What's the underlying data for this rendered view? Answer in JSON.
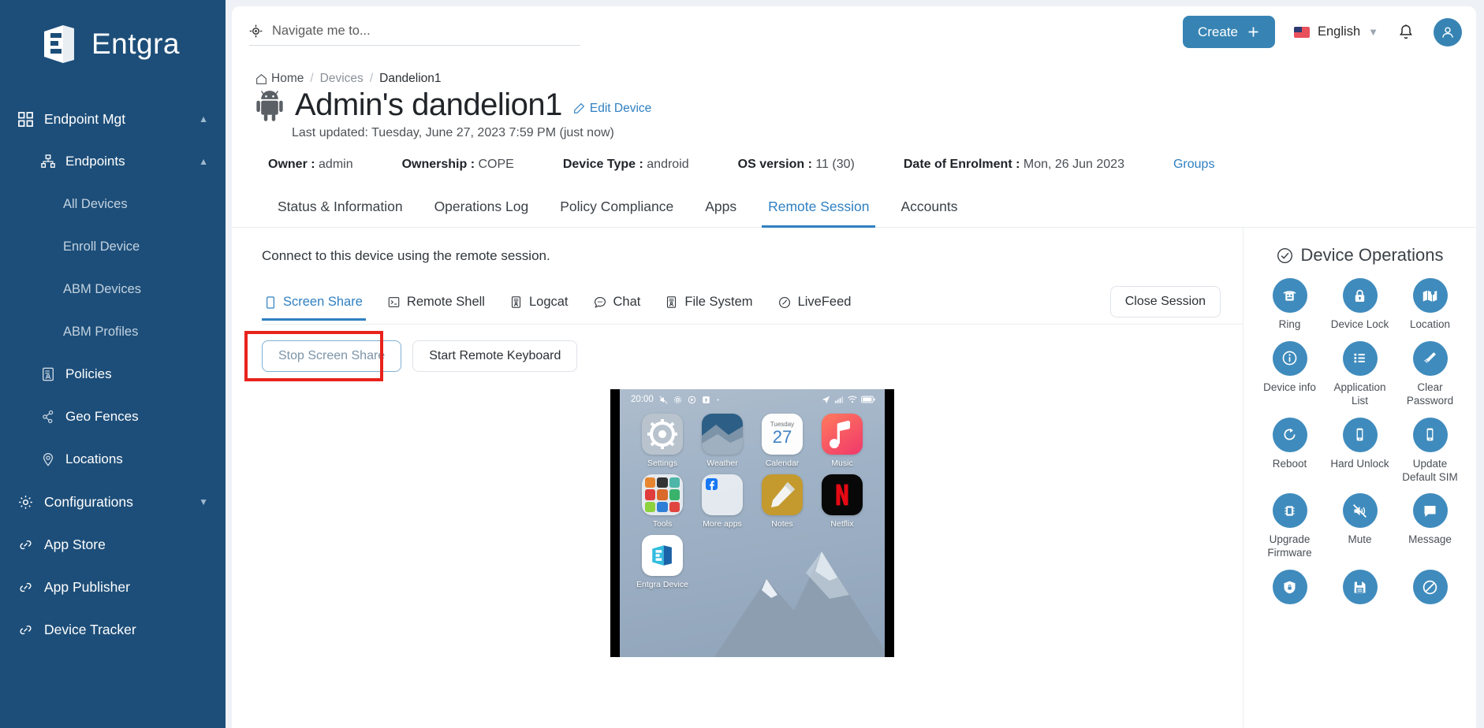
{
  "brand": {
    "name": "Entgra",
    "logo_icon": "entgra-logo-icon"
  },
  "sidebar": {
    "sections": [
      {
        "label": "Endpoint Mgt",
        "icon": "grid-icon",
        "level": "top",
        "expanded": true,
        "chevron": "chevron-up-icon"
      },
      {
        "label": "Endpoints",
        "icon": "sitemap-icon",
        "level": "sub",
        "expanded": true,
        "chevron": "chevron-up-icon"
      },
      {
        "label": "All Devices",
        "icon": "",
        "level": "leaf"
      },
      {
        "label": "Enroll Device",
        "icon": "",
        "level": "leaf"
      },
      {
        "label": "ABM Devices",
        "icon": "",
        "level": "leaf"
      },
      {
        "label": "ABM Profiles",
        "icon": "",
        "level": "leaf"
      },
      {
        "label": "Policies",
        "icon": "policy-icon",
        "level": "sub"
      },
      {
        "label": "Geo Fences",
        "icon": "geofence-icon",
        "level": "sub"
      },
      {
        "label": "Locations",
        "icon": "location-pin-icon",
        "level": "sub"
      },
      {
        "label": "Configurations",
        "icon": "gear-icon",
        "level": "top",
        "expanded": false,
        "chevron": "chevron-down-icon"
      },
      {
        "label": "App Store",
        "icon": "link-icon",
        "level": "top"
      },
      {
        "label": "App Publisher",
        "icon": "link-icon",
        "level": "top"
      },
      {
        "label": "Device Tracker",
        "icon": "link-icon",
        "level": "top"
      }
    ]
  },
  "topbar": {
    "search_placeholder": "Navigate me to...",
    "search_value": "",
    "search_icon": "navigate-icon",
    "create_label": "Create",
    "create_icon": "plus-icon",
    "language": "English",
    "language_chevron": "chevron-down-icon",
    "bell_icon": "bell-icon",
    "avatar_icon": "user-avatar-icon"
  },
  "breadcrumb": {
    "home": "Home",
    "items": [
      "Devices",
      "Dandelion1"
    ],
    "home_icon": "home-icon",
    "separator": "/"
  },
  "device": {
    "platform_icon": "android-robot-icon",
    "title": "Admin's dandelion1",
    "edit_label": "Edit Device",
    "edit_icon": "pencil-icon",
    "last_updated": "Last updated: Tuesday, June 27, 2023 7:59 PM (just now)",
    "meta": [
      {
        "key": "Owner :",
        "value": "admin"
      },
      {
        "key": "Ownership :",
        "value": "COPE"
      },
      {
        "key": "Device Type :",
        "value": "android"
      },
      {
        "key": "OS version :",
        "value": "11 (30)"
      },
      {
        "key": "Date of Enrolment :",
        "value": "Mon, 26 Jun 2023"
      }
    ],
    "groups_link": "Groups"
  },
  "tabs": [
    {
      "label": "Status & Information",
      "active": false
    },
    {
      "label": "Operations Log",
      "active": false
    },
    {
      "label": "Policy Compliance",
      "active": false
    },
    {
      "label": "Apps",
      "active": false
    },
    {
      "label": "Remote Session",
      "active": true
    },
    {
      "label": "Accounts",
      "active": false
    }
  ],
  "remote_session": {
    "description": "Connect to this device using the remote session.",
    "subtabs": [
      {
        "label": "Screen Share",
        "icon": "mobile-screen-icon",
        "active": true
      },
      {
        "label": "Remote Shell",
        "icon": "terminal-icon",
        "active": false
      },
      {
        "label": "Logcat",
        "icon": "log-icon",
        "active": false
      },
      {
        "label": "Chat",
        "icon": "chat-bubble-icon",
        "active": false
      },
      {
        "label": "File System",
        "icon": "file-system-icon",
        "active": false
      },
      {
        "label": "LiveFeed",
        "icon": "livefeed-icon",
        "active": false
      }
    ],
    "close_session_label": "Close Session",
    "stop_screen_share_label": "Stop Screen Share",
    "start_remote_keyboard_label": "Start Remote Keyboard",
    "highlight_color": "#e8231c",
    "accent_color": "#2f80c2"
  },
  "phone_preview": {
    "status_time": "20:00",
    "status_icons_left": [
      "mute-icon",
      "gear-icon",
      "cast-icon",
      "vpn-icon",
      "dot-icon"
    ],
    "status_icons_right": [
      "location-arrow-icon",
      "signal-icon",
      "wifi-icon",
      "battery-icon"
    ],
    "apps": [
      {
        "label": "Settings",
        "icon": "settings-gear-icon"
      },
      {
        "label": "Weather",
        "icon": "weather-icon"
      },
      {
        "label": "Calendar",
        "icon": "calendar-icon",
        "day_name": "Tuesday",
        "day_number": "27"
      },
      {
        "label": "Music",
        "icon": "music-note-icon"
      },
      {
        "label": "Tools",
        "icon": "folder-tools-icon"
      },
      {
        "label": "More apps",
        "icon": "folder-more-apps-icon"
      },
      {
        "label": "Notes",
        "icon": "notes-pencil-icon"
      },
      {
        "label": "Netflix",
        "icon": "netflix-icon"
      },
      {
        "label": "Entgra Device",
        "icon": "entgra-app-icon"
      }
    ]
  },
  "device_operations": {
    "title": "Device Operations",
    "title_icon": "check-circle-icon",
    "accent_color": "#3f8bbd",
    "operations": [
      {
        "label": "Ring",
        "icon": "ring-phone-icon"
      },
      {
        "label": "Device Lock",
        "icon": "lock-icon"
      },
      {
        "label": "Location",
        "icon": "map-icon"
      },
      {
        "label": "Device info",
        "icon": "info-icon"
      },
      {
        "label": "Application List",
        "icon": "list-icon"
      },
      {
        "label": "Clear Password",
        "icon": "broom-icon"
      },
      {
        "label": "Reboot",
        "icon": "reboot-icon"
      },
      {
        "label": "Hard Unlock",
        "icon": "mobile-icon"
      },
      {
        "label": "Update Default SIM",
        "icon": "sim-mobile-icon"
      },
      {
        "label": "Upgrade Firmware",
        "icon": "chip-icon"
      },
      {
        "label": "Mute",
        "icon": "mute-speaker-icon"
      },
      {
        "label": "Message",
        "icon": "message-icon"
      },
      {
        "label": "",
        "icon": "shield-lock-icon"
      },
      {
        "label": "",
        "icon": "save-disk-icon"
      },
      {
        "label": "",
        "icon": "block-icon"
      }
    ]
  }
}
